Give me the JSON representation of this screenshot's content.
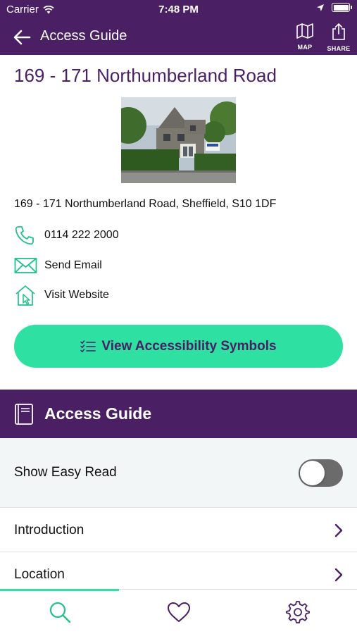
{
  "status_bar": {
    "carrier": "Carrier",
    "time": "7:48 PM"
  },
  "nav": {
    "title": "Access Guide",
    "map_label": "MAP",
    "share_label": "SHARE"
  },
  "venue": {
    "name": "169 - 171 Northumberland Road",
    "address": "169 - 171 Northumberland Road, Sheffield, S10 1DF"
  },
  "contacts": {
    "phone": "0114 222 2000",
    "email": "Send Email",
    "website": "Visit Website"
  },
  "cta": {
    "label": "View Accessibility Symbols"
  },
  "section": {
    "title": "Access Guide",
    "easy_read_label": "Show Easy Read",
    "easy_read_on": false
  },
  "list": [
    {
      "label": "Introduction"
    },
    {
      "label": "Location"
    }
  ],
  "tabs": {
    "active": "search",
    "items": [
      "search-icon",
      "heart-icon",
      "gear-icon"
    ]
  },
  "colors": {
    "brand_purple": "#4a1f64",
    "accent_green": "#2ee0a1",
    "icon_teal": "#22c08a"
  }
}
